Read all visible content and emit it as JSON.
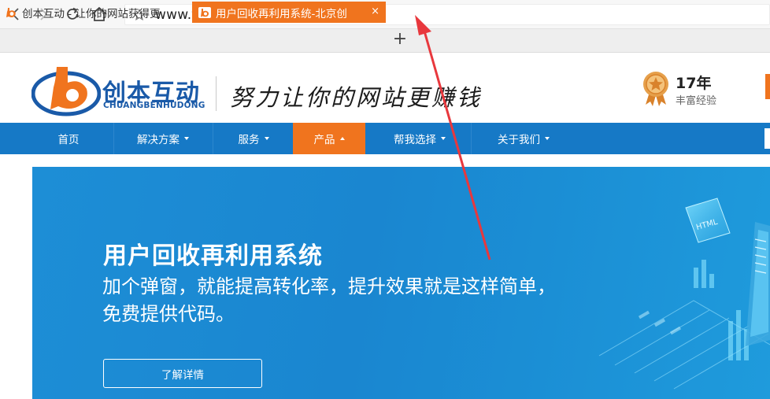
{
  "browser": {
    "url": "www.truben.com/ur/",
    "tabs": [
      {
        "title": "创本互动 - 让你的网站获得更",
        "active": false
      },
      {
        "title": "用户回收再利用系统-北京创",
        "active": true
      }
    ],
    "close_glyph": "×",
    "new_tab_glyph": "+"
  },
  "header": {
    "logo_name": "创本互动",
    "logo_pinyin": "CHUANGBENHUDONG",
    "slogan": "努力让你的网站更赚钱",
    "years": "17年",
    "years_sub": "丰富经验"
  },
  "nav": {
    "items": [
      {
        "label": "首页",
        "dropdown": false,
        "active": false
      },
      {
        "label": "解决方案",
        "dropdown": true,
        "active": false
      },
      {
        "label": "服务",
        "dropdown": true,
        "active": false
      },
      {
        "label": "产品",
        "dropdown": true,
        "active": true
      },
      {
        "label": "帮我选择",
        "dropdown": true,
        "active": false
      },
      {
        "label": "关于我们",
        "dropdown": true,
        "active": false
      }
    ]
  },
  "hero": {
    "title": "用户回收再利用系统",
    "desc_line1": "加个弹窗，就能提高转化率，提升效果就是这样简单，",
    "desc_line2": "免费提供代码。",
    "button_label": "了解详情",
    "html_badge": "HTML"
  },
  "colors": {
    "brand_blue": "#1679c6",
    "brand_orange": "#f0741e",
    "hero_blue": "#1a86d0",
    "annotation_red": "#e8383d"
  },
  "icons": [
    "back-icon",
    "forward-icon",
    "reload-icon",
    "home-icon",
    "bookmark-star-icon",
    "site-favicon",
    "medal-icon",
    "close-icon",
    "plus-icon",
    "chevron-down-icon",
    "chevron-up-icon"
  ]
}
